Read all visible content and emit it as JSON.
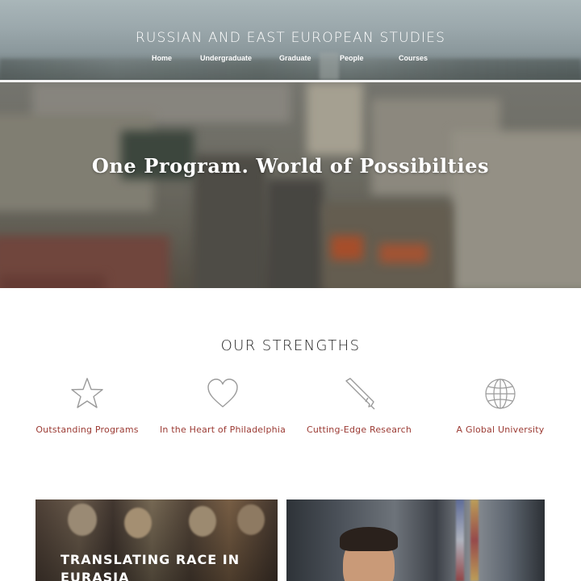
{
  "header": {
    "site_title": "RUSSIAN AND EAST EUROPEAN STUDIES",
    "nav": [
      {
        "label": "Home"
      },
      {
        "label": "Undergraduate"
      },
      {
        "label": "Graduate"
      },
      {
        "label": "People"
      },
      {
        "label": "Courses"
      }
    ]
  },
  "hero": {
    "heading": "One Program. World of Possibilties"
  },
  "strengths": {
    "title": "OUR STRENGTHS",
    "items": [
      {
        "icon": "star-icon",
        "label": "Outstanding Programs"
      },
      {
        "icon": "heart-icon",
        "label": "In the Heart of Philadelphia"
      },
      {
        "icon": "pencil-icon",
        "label": "Cutting-Edge Research"
      },
      {
        "icon": "globe-icon",
        "label": "A Global University"
      }
    ]
  },
  "cards": [
    {
      "title": "TRANSLATING RACE IN EURASIA"
    },
    {
      "title": ""
    }
  ],
  "colors": {
    "accent_link": "#9b3a33",
    "heading_text": "#222222",
    "icon_stroke": "#9a9a9a"
  }
}
